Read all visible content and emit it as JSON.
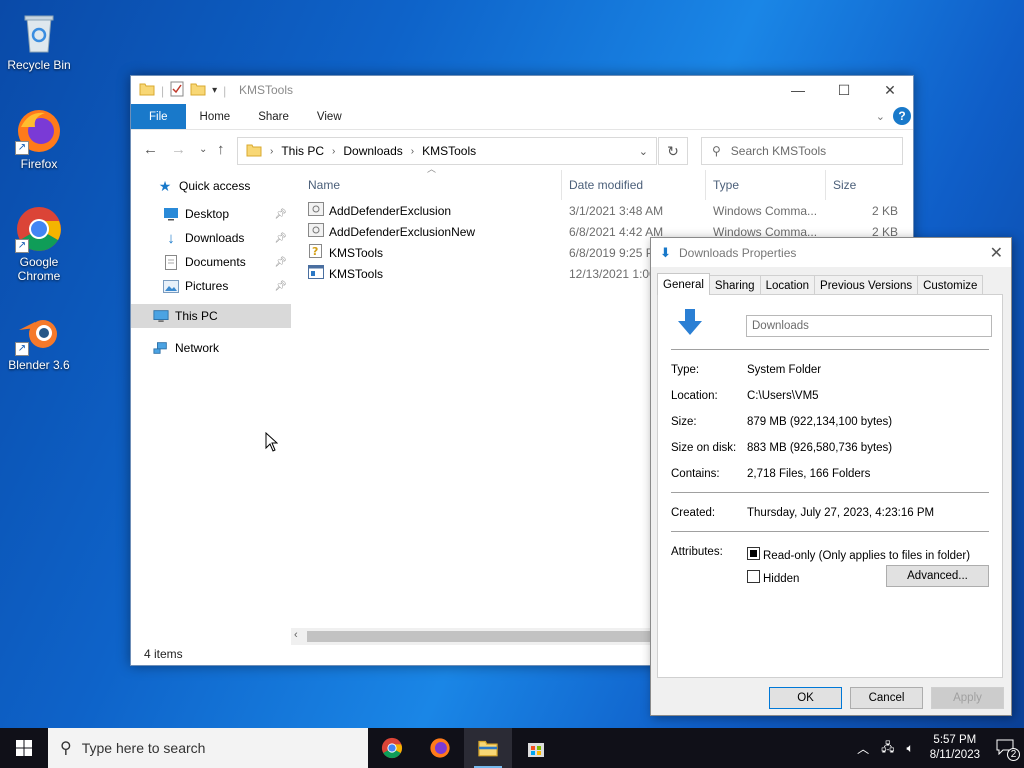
{
  "desktop": {
    "icons": [
      {
        "label": "Recycle Bin"
      },
      {
        "label": "Firefox"
      },
      {
        "label": "Google Chrome"
      },
      {
        "label": "Blender 3.6"
      }
    ]
  },
  "explorer": {
    "title": "KMSTools",
    "ribbon_tabs": [
      "File",
      "Home",
      "Share",
      "View"
    ],
    "breadcrumb": [
      "This PC",
      "Downloads",
      "KMSTools"
    ],
    "search_placeholder": "Search KMSTools",
    "nav": {
      "quick_access": "Quick access",
      "items": [
        "Desktop",
        "Downloads",
        "Documents",
        "Pictures"
      ],
      "this_pc": "This PC",
      "network": "Network"
    },
    "columns": [
      "Name",
      "Date modified",
      "Type",
      "Size"
    ],
    "files": [
      {
        "name": "AddDefenderExclusion",
        "date": "3/1/2021 3:48 AM",
        "type": "Windows Comma...",
        "size": "2 KB"
      },
      {
        "name": "AddDefenderExclusionNew",
        "date": "6/8/2021 4:42 AM",
        "type": "Windows Comma...",
        "size": "2 KB"
      },
      {
        "name": "KMSTools",
        "date": "6/8/2019 9:25 PM",
        "type": "",
        "size": ""
      },
      {
        "name": "KMSTools",
        "date": "12/13/2021 1:00",
        "type": "",
        "size": ""
      }
    ],
    "status": "4 items"
  },
  "properties": {
    "title": "Downloads Properties",
    "tabs": [
      "General",
      "Sharing",
      "Location",
      "Previous Versions",
      "Customize"
    ],
    "name_value": "Downloads",
    "type_label": "Type:",
    "type_value": "System Folder",
    "location_label": "Location:",
    "location_value": "C:\\Users\\VM5",
    "size_label": "Size:",
    "size_value": "879 MB (922,134,100 bytes)",
    "size_on_disk_label": "Size on disk:",
    "size_on_disk_value": "883 MB (926,580,736 bytes)",
    "contains_label": "Contains:",
    "contains_value": "2,718 Files, 166 Folders",
    "created_label": "Created:",
    "created_value": "Thursday, July 27, 2023, 4:23:16 PM",
    "attributes_label": "Attributes:",
    "readonly_label": "Read-only (Only applies to files in folder)",
    "hidden_label": "Hidden",
    "advanced_label": "Advanced...",
    "ok_label": "OK",
    "cancel_label": "Cancel",
    "apply_label": "Apply"
  },
  "taskbar": {
    "search_placeholder": "Type here to search",
    "time": "5:57 PM",
    "date": "8/11/2023",
    "notification_count": "2"
  },
  "colors": {
    "accent": "#1979ca",
    "taskbar": "#101018"
  }
}
